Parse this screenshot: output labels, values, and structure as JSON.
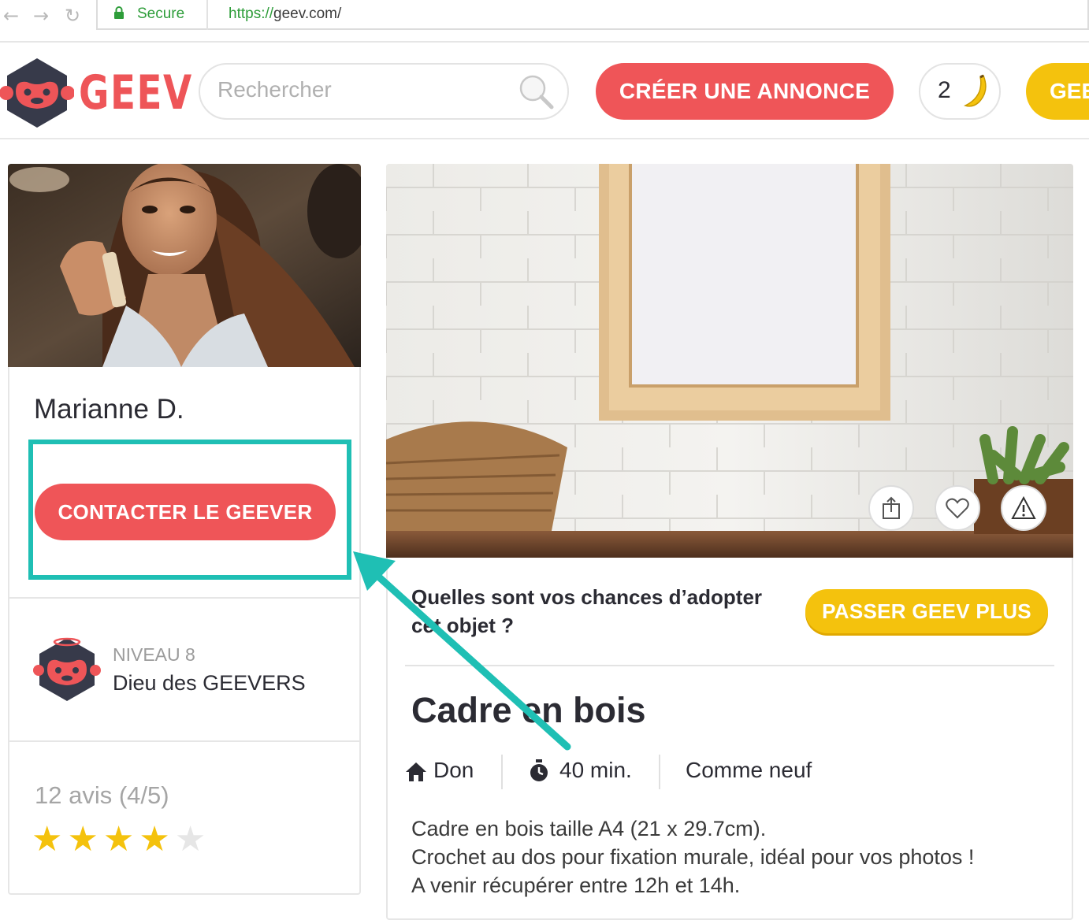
{
  "browser": {
    "secure_label": "Secure",
    "url_scheme": "https://",
    "url_rest": "geev.com/"
  },
  "header": {
    "logo_text": "GEEV",
    "search_placeholder": "Rechercher",
    "create_label": "CRÉER UNE ANNONCE",
    "banana_count": "2",
    "geev_plus_label": "GEE"
  },
  "seller": {
    "name": "Marianne D.",
    "contact_label": "CONTACTER LE GEEVER",
    "level_label": "NIVEAU 8",
    "level_title": "Dieu des GEEVERS",
    "reviews": "12 avis (4/5)",
    "rating": 4,
    "rating_max": 5
  },
  "listing": {
    "chance_question": "Quelles sont vos chances d’adopter cet objet ?",
    "plus_label": "PASSER GEEV PLUS",
    "title": "Cadre en bois",
    "type": "Don",
    "time": "40 min.",
    "condition": "Comme neuf",
    "description": [
      "Cadre en bois taille A4 (21 x 29.7cm).",
      "Crochet au dos pour fixation murale, idéal pour vos photos !",
      "A venir récupérer entre 12h et 14h."
    ]
  },
  "colors": {
    "brand_red": "#ef5558",
    "brand_yellow": "#f4c20d",
    "highlight_teal": "#1fbfb4",
    "secure_green": "#2e9d3a"
  }
}
